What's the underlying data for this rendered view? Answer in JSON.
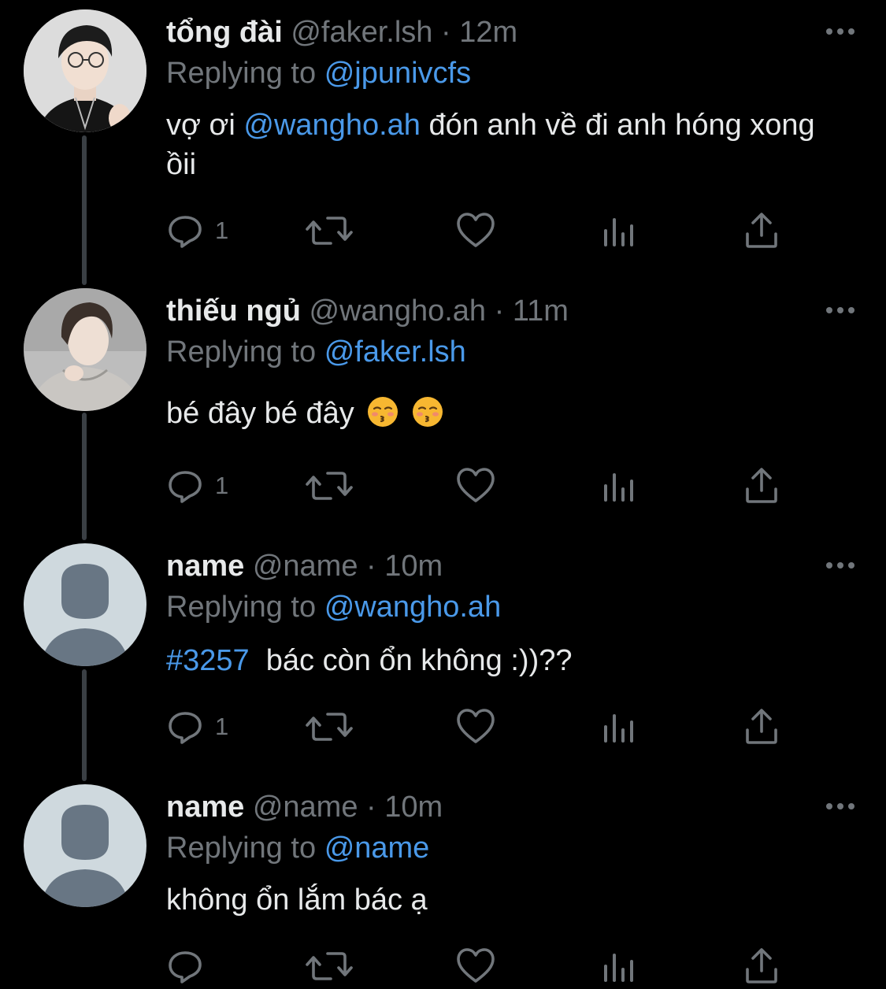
{
  "tweets": [
    {
      "display_name": "tổng đài",
      "handle": "@faker.lsh",
      "separator": "·",
      "time": "12m",
      "replying_prefix": "Replying to",
      "replying_to": "@jpunivcfs",
      "body": {
        "pre": "vợ ơi ",
        "mention": "@wangho.ah",
        "post": " đón anh về đi anh hóng xong ồii"
      },
      "reply_count": "1",
      "avatar": "photo-avatar"
    },
    {
      "display_name": "thiếu ngủ",
      "handle": "@wangho.ah",
      "separator": "·",
      "time": "11m",
      "replying_prefix": "Replying to",
      "replying_to": "@faker.lsh",
      "body": {
        "text": "bé đây bé đây",
        "emojis": [
          "kissing-face-with-closed-eyes",
          "kissing-face-with-closed-eyes"
        ]
      },
      "reply_count": "1",
      "avatar": "photo-avatar"
    },
    {
      "display_name": "name",
      "handle": "@name",
      "separator": "·",
      "time": "10m",
      "replying_prefix": "Replying to",
      "replying_to": "@wangho.ah",
      "body": {
        "hashtag": "#3257",
        "post": "  bác còn ổn không :))??"
      },
      "reply_count": "1",
      "avatar": "default-avatar"
    },
    {
      "display_name": "name",
      "handle": "@name",
      "separator": "·",
      "time": "10m",
      "replying_prefix": "Replying to",
      "replying_to": "@name",
      "body": {
        "text": "không ổn lắm bác ạ"
      },
      "reply_count": "",
      "avatar": "default-avatar"
    }
  ],
  "colors": {
    "background": "#000000",
    "text_primary": "#e7e9ea",
    "text_secondary": "#71767b",
    "accent_link": "#4a99e9",
    "thread_line": "#3a3f44",
    "default_avatar_bg": "#cfd9de",
    "default_avatar_fg": "#687684"
  },
  "icons": {
    "reply": "reply-icon",
    "retweet": "retweet-icon",
    "like": "heart-icon",
    "analytics": "analytics-icon",
    "share": "share-icon",
    "more": "more-icon"
  }
}
